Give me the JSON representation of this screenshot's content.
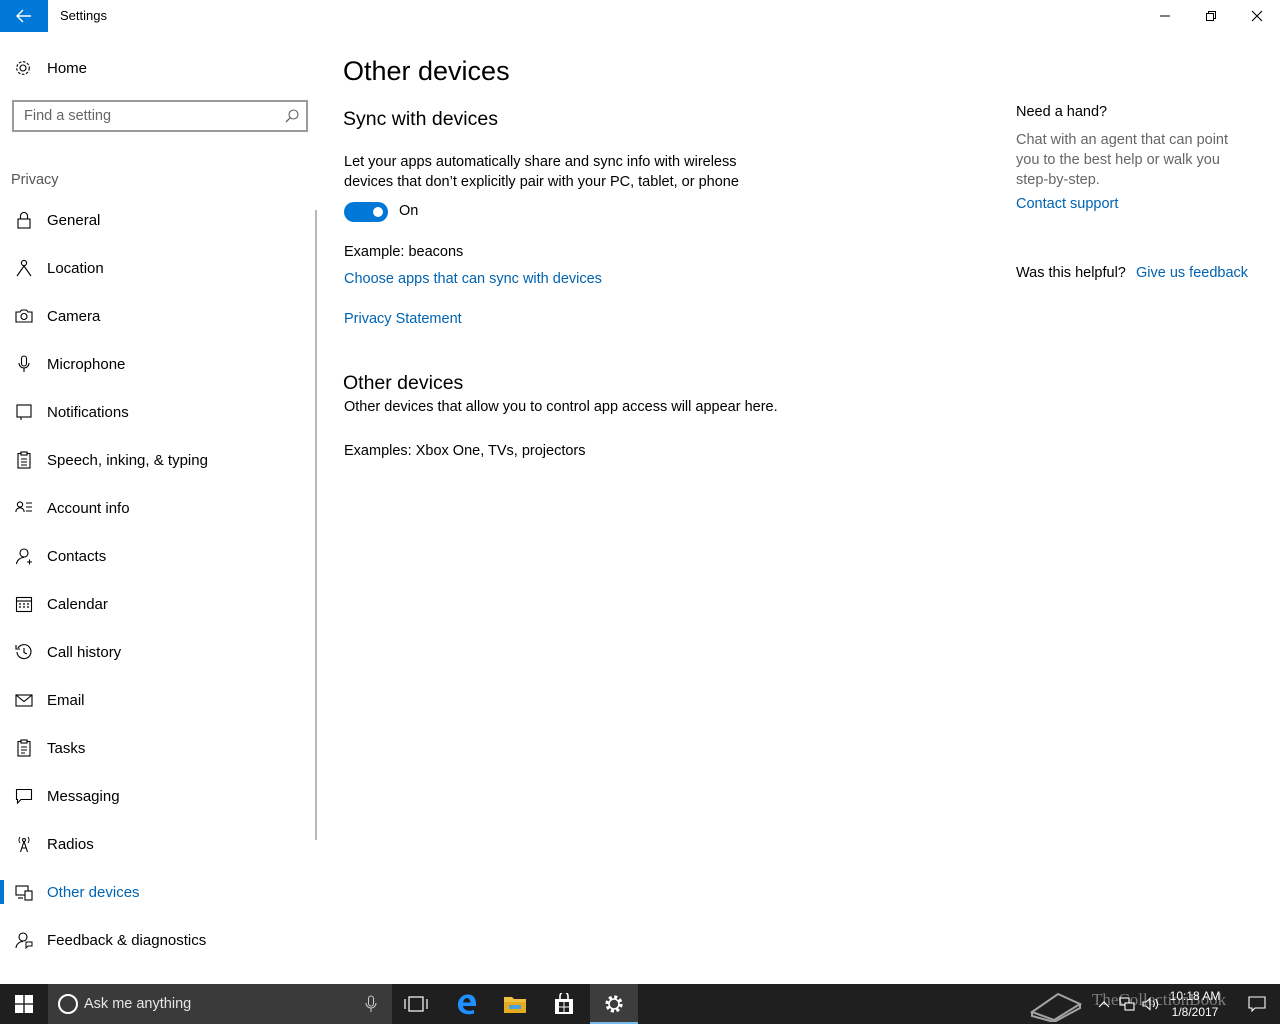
{
  "window": {
    "title": "Settings",
    "back_icon": "back-arrow-icon",
    "accent": "#0078d7"
  },
  "nav": {
    "home_label": "Home",
    "search_placeholder": "Find a setting",
    "section": "Privacy",
    "items": [
      {
        "label": "General",
        "icon": "lock-icon"
      },
      {
        "label": "Location",
        "icon": "location-person-icon"
      },
      {
        "label": "Camera",
        "icon": "camera-icon"
      },
      {
        "label": "Microphone",
        "icon": "microphone-icon"
      },
      {
        "label": "Notifications",
        "icon": "notification-icon"
      },
      {
        "label": "Speech, inking, & typing",
        "icon": "clipboard-icon"
      },
      {
        "label": "Account info",
        "icon": "account-info-icon"
      },
      {
        "label": "Contacts",
        "icon": "contacts-icon"
      },
      {
        "label": "Calendar",
        "icon": "calendar-icon"
      },
      {
        "label": "Call history",
        "icon": "history-icon"
      },
      {
        "label": "Email",
        "icon": "email-icon"
      },
      {
        "label": "Tasks",
        "icon": "tasks-icon"
      },
      {
        "label": "Messaging",
        "icon": "messaging-icon"
      },
      {
        "label": "Radios",
        "icon": "radio-tower-icon"
      },
      {
        "label": "Other devices",
        "icon": "devices-icon",
        "active": true
      },
      {
        "label": "Feedback & diagnostics",
        "icon": "feedback-icon"
      }
    ]
  },
  "main": {
    "page_title": "Other devices",
    "sync_heading": "Sync with devices",
    "sync_description": "Let your apps automatically share and sync info with wireless devices that don’t explicitly pair with your PC, tablet, or phone",
    "toggle_state": "On",
    "example_beacons": "Example: beacons",
    "choose_apps_link": "Choose apps that can sync with devices",
    "privacy_link": "Privacy Statement",
    "other_heading": "Other devices",
    "other_description": "Other devices that allow you to control app access will appear here.",
    "examples_devices": "Examples: Xbox One, TVs, projectors"
  },
  "help": {
    "question": "Need a hand?",
    "description": "Chat with an agent that can point you to the best help or walk you step-by-step.",
    "contact_link": "Contact support",
    "helpful_question": "Was this helpful?",
    "feedback_link": "Give us feedback"
  },
  "taskbar": {
    "search_placeholder": "Ask me anything",
    "time": "10:18 AM",
    "date": "1/8/2017",
    "watermark": "TheCollectionBook"
  }
}
